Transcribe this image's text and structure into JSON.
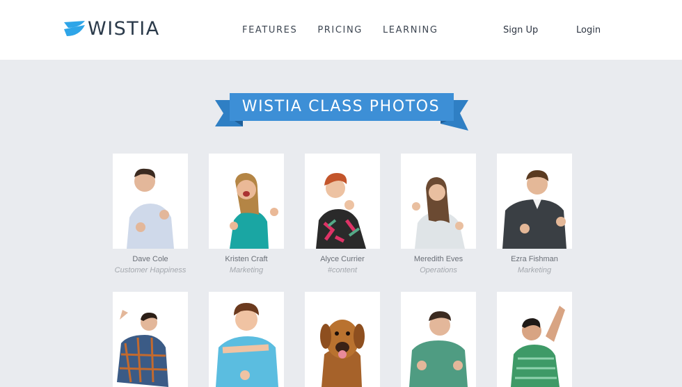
{
  "brand": {
    "name": "WISTIA",
    "color": "#2ea5e8"
  },
  "nav": {
    "items": [
      "FEATURES",
      "PRICING",
      "LEARNING"
    ],
    "signup": "Sign Up",
    "login": "Login"
  },
  "banner": {
    "title": "WISTIA CLASS PHOTOS",
    "color": "#3d8fd6"
  },
  "people": [
    {
      "name": "Dave Cole",
      "role": "Customer Happiness",
      "shirt": "#cfd9ea"
    },
    {
      "name": "Kristen Craft",
      "role": "Marketing",
      "shirt": "#1aa6a3"
    },
    {
      "name": "Alyce Currier",
      "role": "#content",
      "shirt": "#2a2a2a"
    },
    {
      "name": "Meredith Eves",
      "role": "Operations",
      "shirt": "#dfe4e7"
    },
    {
      "name": "Ezra Fishman",
      "role": "Marketing",
      "shirt": "#3a3f44"
    }
  ],
  "people_row2": [
    {
      "shirt": "#3b5b86",
      "icon": "person-photo"
    },
    {
      "shirt": "#5bbde0",
      "icon": "person-photo"
    },
    {
      "shirt": "#b9722f",
      "icon": "dog-photo"
    },
    {
      "shirt": "#4f9c82",
      "icon": "person-photo"
    },
    {
      "shirt": "#3e9a67",
      "icon": "person-photo"
    }
  ]
}
